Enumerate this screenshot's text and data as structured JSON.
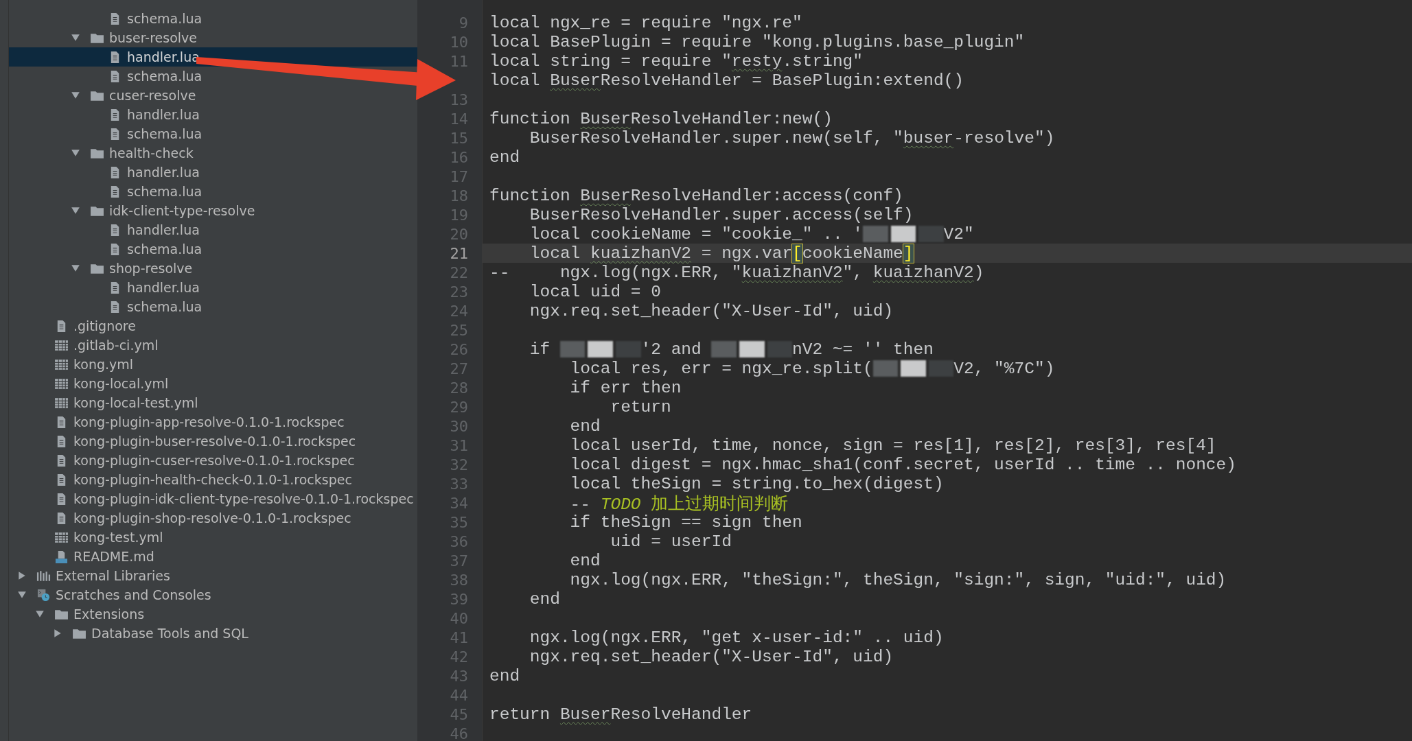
{
  "project_tree": [
    {
      "children": [
        {
          "children": [
            {
              "children": [
                {
                  "children": [
                    {
                      "label": "schema.lua",
                      "kind": "file",
                      "selected": false
                    }
                  ]
                },
                {
                  "label": "buser-resolve",
                  "kind": "folder",
                  "expanded": true,
                  "selected": false,
                  "children": [
                    {
                      "label": "handler.lua",
                      "kind": "file",
                      "selected": true
                    },
                    {
                      "label": "schema.lua",
                      "kind": "file",
                      "selected": false
                    }
                  ]
                },
                {
                  "label": "cuser-resolve",
                  "kind": "folder",
                  "expanded": true,
                  "selected": false,
                  "children": [
                    {
                      "label": "handler.lua",
                      "kind": "file",
                      "selected": false
                    },
                    {
                      "label": "schema.lua",
                      "kind": "file",
                      "selected": false
                    }
                  ]
                },
                {
                  "label": "health-check",
                  "kind": "folder",
                  "expanded": true,
                  "selected": false,
                  "children": [
                    {
                      "label": "handler.lua",
                      "kind": "file",
                      "selected": false
                    },
                    {
                      "label": "schema.lua",
                      "kind": "file",
                      "selected": false
                    }
                  ]
                },
                {
                  "label": "idk-client-type-resolve",
                  "kind": "folder",
                  "expanded": true,
                  "selected": false,
                  "children": [
                    {
                      "label": "handler.lua",
                      "kind": "file",
                      "selected": false
                    },
                    {
                      "label": "schema.lua",
                      "kind": "file",
                      "selected": false
                    }
                  ]
                },
                {
                  "label": "shop-resolve",
                  "kind": "folder",
                  "expanded": true,
                  "selected": false,
                  "children": [
                    {
                      "label": "handler.lua",
                      "kind": "file",
                      "selected": false
                    },
                    {
                      "label": "schema.lua",
                      "kind": "file",
                      "selected": false
                    }
                  ]
                }
              ]
            }
          ]
        },
        {
          "label": ".gitignore",
          "kind": "file",
          "selected": false
        },
        {
          "label": ".gitlab-ci.yml",
          "kind": "yml",
          "selected": false
        },
        {
          "label": "kong.yml",
          "kind": "yml",
          "selected": false
        },
        {
          "label": "kong-local.yml",
          "kind": "yml",
          "selected": false
        },
        {
          "label": "kong-local-test.yml",
          "kind": "yml",
          "selected": false
        },
        {
          "label": "kong-plugin-app-resolve-0.1.0-1.rockspec",
          "kind": "file",
          "selected": false
        },
        {
          "label": "kong-plugin-buser-resolve-0.1.0-1.rockspec",
          "kind": "file",
          "selected": false
        },
        {
          "label": "kong-plugin-cuser-resolve-0.1.0-1.rockspec",
          "kind": "file",
          "selected": false
        },
        {
          "label": "kong-plugin-health-check-0.1.0-1.rockspec",
          "kind": "file",
          "selected": false
        },
        {
          "label": "kong-plugin-idk-client-type-resolve-0.1.0-1.rockspec",
          "kind": "file",
          "selected": false
        },
        {
          "label": "kong-plugin-shop-resolve-0.1.0-1.rockspec",
          "kind": "file",
          "selected": false
        },
        {
          "label": "kong-test.yml",
          "kind": "yml",
          "selected": false
        },
        {
          "label": "README.md",
          "kind": "md",
          "selected": false
        }
      ]
    },
    {
      "label": "External Libraries",
      "kind": "libraries",
      "expanded": false,
      "selected": false
    },
    {
      "label": "Scratches and Consoles",
      "kind": "scratches",
      "expanded": true,
      "selected": false,
      "children": [
        {
          "label": "Extensions",
          "kind": "folder",
          "expanded": true,
          "selected": false,
          "children": [
            {
              "label": "Database Tools and SQL",
              "kind": "folder",
              "expanded": false,
              "selected": false
            }
          ]
        }
      ]
    }
  ],
  "editor": {
    "lines": [
      {
        "number": "9",
        "current": false,
        "segments": [
          {
            "text": "local ngx_re = require \"ngx.re\""
          }
        ]
      },
      {
        "number": "10",
        "current": false,
        "segments": [
          {
            "text": "local BasePlugin = require \"kong.plugins.base_plugin\""
          }
        ]
      },
      {
        "number": "11",
        "current": false,
        "segments": [
          {
            "text": "local string = require \""
          },
          {
            "text": "resty",
            "kind": "typo"
          },
          {
            "text": ".string\""
          }
        ]
      },
      {
        "current": false,
        "segments": [
          {
            "text": "local "
          },
          {
            "text": "Buser",
            "kind": "typo"
          },
          {
            "text": "ResolveHandler = BasePlugin:extend()"
          }
        ]
      },
      {
        "number": "13",
        "current": false
      },
      {
        "number": "14",
        "current": false,
        "segments": [
          {
            "text": "function "
          },
          {
            "text": "Buser",
            "kind": "typo"
          },
          {
            "text": "ResolveHandler:new()"
          }
        ]
      },
      {
        "number": "15",
        "current": false,
        "segments": [
          {
            "text": "    BuserResolveHandler.super.new(self, \""
          },
          {
            "text": "buser",
            "kind": "typo"
          },
          {
            "text": "-resolve\")"
          }
        ]
      },
      {
        "number": "16",
        "current": false,
        "segments": [
          {
            "text": "end"
          }
        ]
      },
      {
        "number": "17",
        "current": false
      },
      {
        "number": "18",
        "current": false,
        "segments": [
          {
            "text": "function "
          },
          {
            "text": "Buser",
            "kind": "typo"
          },
          {
            "text": "ResolveHandler:access(conf)"
          }
        ]
      },
      {
        "number": "19",
        "current": false,
        "segments": [
          {
            "text": "    BuserResolveHandler.super.access(self)"
          }
        ]
      },
      {
        "number": "20",
        "current": false,
        "segments": [
          {
            "text": "    local cookieName = \"cookie_\" .. '"
          },
          {
            "kind": "redaction"
          },
          {
            "text": "V2\""
          }
        ]
      },
      {
        "number": "21",
        "current": true,
        "segments": [
          {
            "text": "    local "
          },
          {
            "text": "kuaizhanV2",
            "kind": "typo"
          },
          {
            "text": " = ngx.var"
          },
          {
            "text": "[",
            "kind": "bracket"
          },
          {
            "text": "cookieName"
          },
          {
            "text": "]",
            "kind": "bracket"
          }
        ]
      },
      {
        "number": "22",
        "current": false,
        "segments": [
          {
            "text": "--     ngx.log(ngx.ERR, \""
          },
          {
            "text": "kuaizhanV2",
            "kind": "typo"
          },
          {
            "text": "\", "
          },
          {
            "text": "kuaizhanV2",
            "kind": "typo"
          },
          {
            "text": ")"
          }
        ]
      },
      {
        "number": "23",
        "current": false,
        "segments": [
          {
            "text": "    local uid = 0"
          }
        ]
      },
      {
        "number": "24",
        "current": false,
        "segments": [
          {
            "text": "    ngx.req.set_header(\"X-User-Id\", uid)"
          }
        ]
      },
      {
        "number": "25",
        "current": false
      },
      {
        "number": "26",
        "current": false,
        "segments": [
          {
            "text": "    if "
          },
          {
            "kind": "redaction"
          },
          {
            "text": "'2 and "
          },
          {
            "kind": "redaction"
          },
          {
            "text": "nV2 ~= '' then"
          }
        ]
      },
      {
        "number": "27",
        "current": false,
        "segments": [
          {
            "text": "        local res, err = ngx_re.split("
          },
          {
            "kind": "redaction"
          },
          {
            "text": "V2, \"%7C\")"
          }
        ]
      },
      {
        "number": "28",
        "current": false,
        "segments": [
          {
            "text": "        if err then"
          }
        ]
      },
      {
        "number": "29",
        "current": false,
        "segments": [
          {
            "text": "            return"
          }
        ]
      },
      {
        "number": "30",
        "current": false,
        "segments": [
          {
            "text": "        end"
          }
        ]
      },
      {
        "number": "31",
        "current": false,
        "segments": [
          {
            "text": "        local userId, time, nonce, sign = res[1], res[2], res[3], res[4]"
          }
        ]
      },
      {
        "number": "32",
        "current": false,
        "segments": [
          {
            "text": "        local digest = ngx.hmac_sha1(conf.secret, userId .. time .. nonce)"
          }
        ]
      },
      {
        "number": "33",
        "current": false,
        "segments": [
          {
            "text": "        local theSign = string.to_hex(digest)"
          }
        ]
      },
      {
        "number": "34",
        "current": false,
        "segments": [
          {
            "text": "        -- "
          },
          {
            "text": "*TODO* 加上过期时间判断",
            "kind": "todo"
          }
        ]
      },
      {
        "number": "35",
        "current": false,
        "segments": [
          {
            "text": "        if theSign == sign then"
          }
        ]
      },
      {
        "number": "36",
        "current": false,
        "segments": [
          {
            "text": "            uid = userId"
          }
        ]
      },
      {
        "number": "37",
        "current": false,
        "segments": [
          {
            "text": "        end"
          }
        ]
      },
      {
        "number": "38",
        "current": false,
        "segments": [
          {
            "text": "        ngx.log(ngx.ERR, \"theSign:\", theSign, \"sign:\", sign, \"uid:\", uid)"
          }
        ]
      },
      {
        "number": "39",
        "current": false,
        "segments": [
          {
            "text": "    end"
          }
        ]
      },
      {
        "number": "40",
        "current": false
      },
      {
        "number": "41",
        "current": false,
        "segments": [
          {
            "text": "    ngx.log(ngx.ERR, \"get x-user-id:\" .. uid)"
          }
        ]
      },
      {
        "number": "42",
        "current": false,
        "segments": [
          {
            "text": "    ngx.req.set_header(\"X-User-Id\", uid)"
          }
        ]
      },
      {
        "number": "43",
        "current": false,
        "segments": [
          {
            "text": "end"
          }
        ]
      },
      {
        "number": "44",
        "current": false
      },
      {
        "number": "45",
        "current": false,
        "segments": [
          {
            "text": "return "
          },
          {
            "text": "Buser",
            "kind": "typo"
          },
          {
            "text": "ResolveHandler"
          }
        ]
      },
      {
        "number": "46",
        "current": false
      }
    ]
  }
}
